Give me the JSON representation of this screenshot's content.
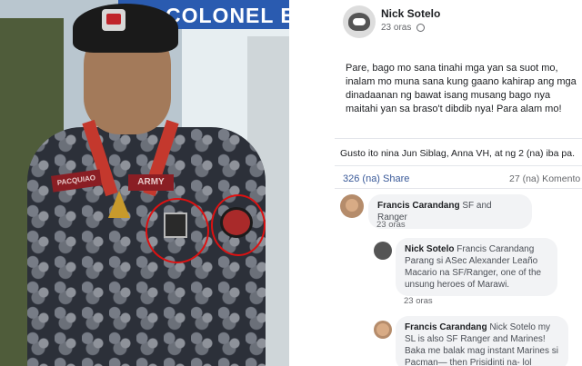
{
  "photo": {
    "banner_text": "COLONEL E",
    "tag_left": "PACQUIAO",
    "tag_right": "ARMY"
  },
  "post": {
    "author": "Nick Sotelo",
    "time": "23 oras",
    "body": "Pare, bago mo sana tinahi mga yan sa suot mo, inalam mo muna sana kung gaano kahirap ang mga dinadaanan ng bawat isang musang bago nya maitahi yan sa braso't dibdib nya! Para alam mo!",
    "likes": "Gusto ito nina Jun Siblag, Anna VH, at ng 2 (na) iba pa.",
    "shares": "326 (na) Share",
    "comments_count": "27 (na) Komento"
  },
  "comments": [
    {
      "name": "Francis Carandang",
      "text": "SF and Ranger",
      "time": "23 oras"
    },
    {
      "name": "Nick Sotelo",
      "text": "Francis Carandang Parang si ASec Alexander Leaño Macario na SF/Ranger, one of the unsung heroes of Marawi.",
      "time": "23 oras"
    },
    {
      "name": "Francis Carandang",
      "text": "Nick Sotelo my SL is also SF Ranger and Marines! Baka me balak mag instant Marines si Pacman— then Prisidinti na- lol",
      "time": ""
    }
  ]
}
